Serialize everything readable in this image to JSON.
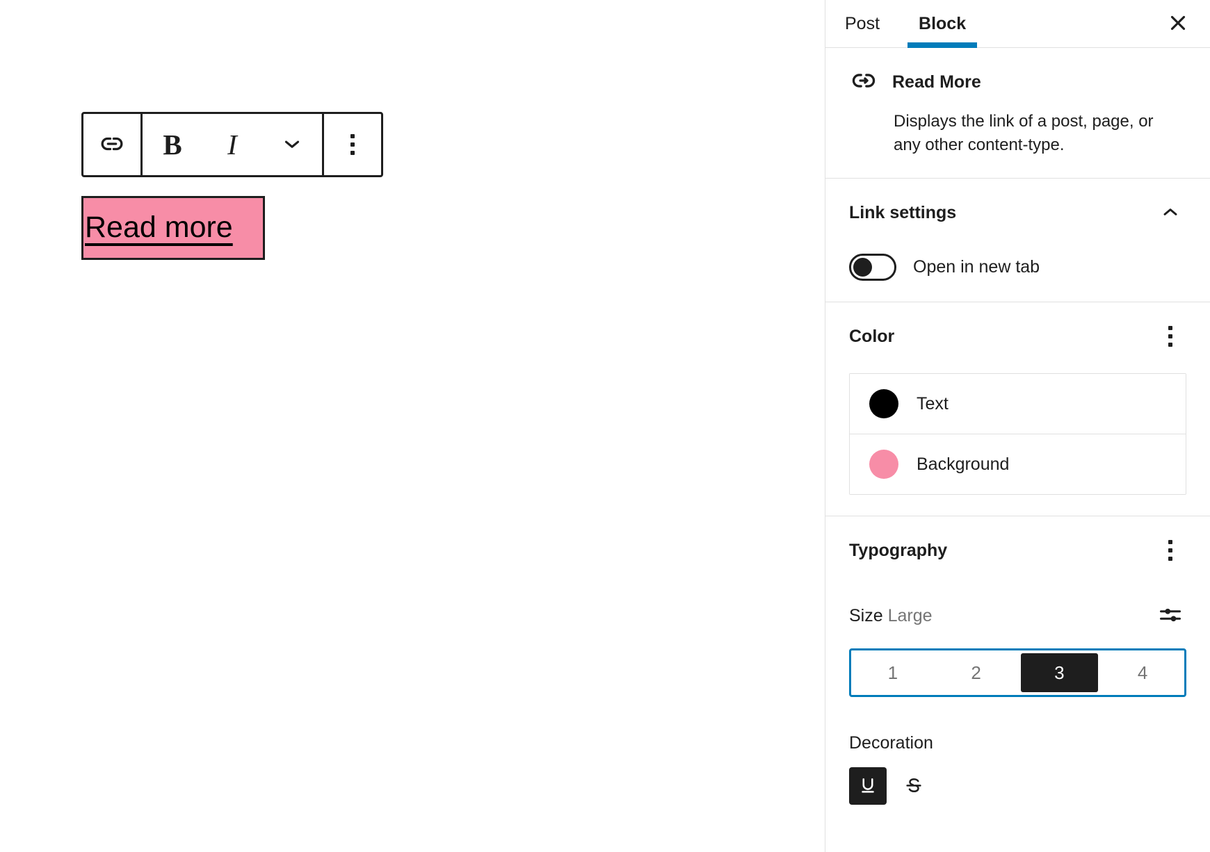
{
  "editor": {
    "toolbar": {
      "link_icon": "link-icon",
      "bold_label": "B",
      "italic_label": "I",
      "more_formats_icon": "chevron-down-icon",
      "options_icon": "more-options-vertical-icon"
    },
    "block": {
      "link_text": "Read more",
      "background_color": "#f78da7",
      "text_color": "#000000",
      "selected_outline_color": "#1e1e1e"
    }
  },
  "sidebar": {
    "tabs": [
      {
        "label": "Post",
        "active": false
      },
      {
        "label": "Block",
        "active": true
      }
    ],
    "active_tab_indicator_color": "#007cba",
    "close_icon": "close-icon",
    "block_card": {
      "icon": "read-more-link-icon",
      "title": "Read More",
      "description": "Displays the link of a post, page, or any other content-type."
    },
    "link_settings": {
      "title": "Link settings",
      "collapse_icon": "chevron-up-icon",
      "open_in_new_tab": {
        "label": "Open in new tab",
        "enabled": false
      }
    },
    "color": {
      "title": "Color",
      "options_icon": "more-options-vertical-icon",
      "items": [
        {
          "label": "Text",
          "swatch": "#000000"
        },
        {
          "label": "Background",
          "swatch": "#f78da7"
        }
      ]
    },
    "typography": {
      "title": "Typography",
      "options_icon": "more-options-vertical-icon",
      "size": {
        "label": "Size",
        "value": "Large",
        "custom_icon": "settings-sliders-icon",
        "steps": [
          "1",
          "2",
          "3",
          "4"
        ],
        "selected_step": "3",
        "focus_color": "#007cba"
      },
      "decoration": {
        "label": "Decoration",
        "buttons": [
          {
            "name": "underline",
            "glyph": "U",
            "active": true
          },
          {
            "name": "strikethrough",
            "glyph": "S",
            "active": false
          }
        ]
      }
    }
  }
}
